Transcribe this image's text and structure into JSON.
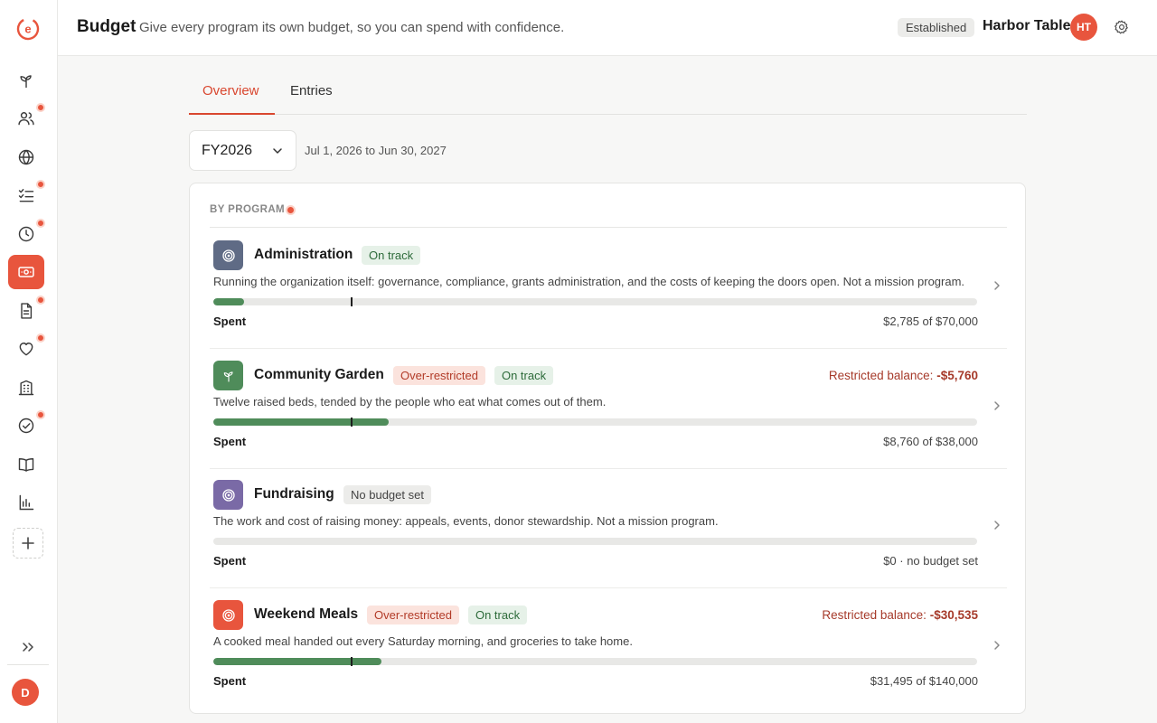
{
  "header": {
    "title": "Budget",
    "subtitle": "Give every program its own budget, so you can spend with confidence.",
    "tier_badge": "Established",
    "org_name": "Harbor Table",
    "org_initials": "HT"
  },
  "sidebar": {
    "items": [
      {
        "icon": "sprout-icon",
        "badge": false,
        "active": false
      },
      {
        "icon": "people-icon",
        "badge": true,
        "active": false
      },
      {
        "icon": "globe-icon",
        "badge": false,
        "active": false
      },
      {
        "icon": "checklist-icon",
        "badge": true,
        "active": false
      },
      {
        "icon": "clock-icon",
        "badge": true,
        "active": false
      },
      {
        "icon": "money-icon",
        "badge": false,
        "active": true
      },
      {
        "icon": "document-icon",
        "badge": true,
        "active": false
      },
      {
        "icon": "heart-icon",
        "badge": true,
        "active": false
      },
      {
        "icon": "building-icon",
        "badge": false,
        "active": false
      },
      {
        "icon": "check-circle-icon",
        "badge": true,
        "active": false
      },
      {
        "icon": "book-icon",
        "badge": false,
        "active": false
      },
      {
        "icon": "bar-chart-icon",
        "badge": false,
        "active": false
      }
    ],
    "user_initial": "D"
  },
  "tabs": [
    {
      "label": "Overview",
      "active": true
    },
    {
      "label": "Entries",
      "active": false
    }
  ],
  "fiscal_year": {
    "value": "FY2026",
    "range": "Jul 1, 2026 to Jun 30, 2027"
  },
  "section_label": "BY PROGRAM",
  "spent_label": "Spent",
  "restricted_label": "Restricted balance:",
  "colors": {
    "accent": "#e8553d",
    "progress": "#4f8c5a"
  },
  "programs": [
    {
      "name": "Administration",
      "icon": "target-icon",
      "icon_color": "#5f6b85",
      "badges": [
        {
          "text": "On track",
          "kind": "ok"
        }
      ],
      "restricted_balance": null,
      "description": "Running the organization itself: governance, compliance, grants administration, and the costs of keeping the doors open. Not a mission program.",
      "spent_fraction": 0.04,
      "marker_fraction": 0.18,
      "spent_text": "$2,785 of $70,000"
    },
    {
      "name": "Community Garden",
      "icon": "sprout-icon",
      "icon_color": "#4f8c5a",
      "badges": [
        {
          "text": "Over-restricted",
          "kind": "warn"
        },
        {
          "text": "On track",
          "kind": "ok"
        }
      ],
      "restricted_balance": "-$5,760",
      "description": "Twelve raised beds, tended by the people who eat what comes out of them.",
      "spent_fraction": 0.23,
      "marker_fraction": 0.18,
      "spent_text": "$8,760 of $38,000"
    },
    {
      "name": "Fundraising",
      "icon": "target-icon",
      "icon_color": "#7a6aa6",
      "badges": [
        {
          "text": "No budget set",
          "kind": "none"
        }
      ],
      "restricted_balance": null,
      "description": "The work and cost of raising money: appeals, events, donor stewardship. Not a mission program.",
      "spent_fraction": 0,
      "marker_fraction": null,
      "spent_text": "$0 · no budget set"
    },
    {
      "name": "Weekend Meals",
      "icon": "target-icon",
      "icon_color": "#e8553d",
      "badges": [
        {
          "text": "Over-restricted",
          "kind": "warn"
        },
        {
          "text": "On track",
          "kind": "ok"
        }
      ],
      "restricted_balance": "-$30,535",
      "description": "A cooked meal handed out every Saturday morning, and groceries to take home.",
      "spent_fraction": 0.22,
      "marker_fraction": 0.18,
      "spent_text": "$31,495 of $140,000"
    }
  ]
}
